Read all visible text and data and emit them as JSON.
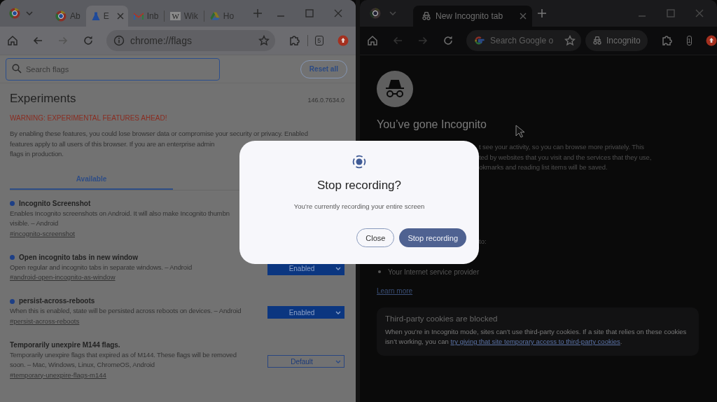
{
  "left_window": {
    "tabs": [
      {
        "kind": "chrome",
        "title": "Ab",
        "selected": false
      },
      {
        "kind": "flask",
        "title": "E",
        "selected": true
      },
      {
        "kind": "mail",
        "title": "Inb",
        "selected": false
      },
      {
        "kind": "letter",
        "favicon_letter": "W",
        "title": "Wik",
        "selected": false
      },
      {
        "kind": "drive",
        "title": "Ho",
        "selected": false
      }
    ],
    "toolbar": {
      "back_disabled": false,
      "forward_disabled": true,
      "address": "chrome://flags",
      "tab_count": "5"
    },
    "search": {
      "placeholder": "Search flags"
    },
    "reset_button": "Reset all",
    "heading": "Experiments",
    "version": "146.0.7634.0",
    "warning": "WARNING: EXPERIMENTAL FEATURES AHEAD!",
    "intro_lines": [
      "By enabling these features, you could lose browser data or compromise your security or privacy. Enabled",
      "features apply to all users of this browser. If you are an enterprise admin",
      "flags in production."
    ],
    "flag_tabs": [
      {
        "label": "Available",
        "selected": true
      }
    ],
    "flags": [
      {
        "name": "Incognito Screenshot",
        "modified": true,
        "description_lines": [
          "Enables Incognito screenshots on Android. It will also make Incognito thumbn",
          "visible. – Android"
        ],
        "link": "#incognito-screenshot"
      },
      {
        "name": "Open incognito tabs in new window",
        "modified": true,
        "description_lines": [
          "Open regular and incognito tabs in separate windows. – Android"
        ],
        "link": "#android-open-incognito-as-window",
        "select": "Enabled"
      },
      {
        "name": "persist-across-reboots",
        "modified": true,
        "description_lines": [
          "When this is enabled, state will be persisted across reboots on devices. – Android"
        ],
        "link": "#persist-across-reboots",
        "select": "Enabled"
      },
      {
        "name": "Temporarily unexpire M144 flags.",
        "modified": false,
        "description_lines": [
          "Temporarily unexpire flags that expired as of M144. These flags will be removed",
          "soon. – Mac, Windows, Linux, ChromeOS, Android"
        ],
        "link": "#temporary-unexpire-flags-m144",
        "select": "Default"
      }
    ]
  },
  "right_window": {
    "tabs": [
      {
        "kind": "incognito",
        "title": "New Incognito tab",
        "selected": true
      }
    ],
    "toolbar": {
      "back_disabled": true,
      "forward_disabled": true,
      "placeholder": "Search Google o",
      "chip": "Incognito",
      "tab_count": "1"
    },
    "heading": "You’ve gone Incognito",
    "intro_fragments": [
      "t see your activity, so you can browse more privately. This",
      "ted by websites that you visit and the services that they use,",
      "okmarks and reading list items will be saved."
    ],
    "list_intro_fragment": "to:",
    "list": [
      "Your Internet service provider"
    ],
    "learn_more": "Learn more",
    "cookies_card": {
      "title": "Third-party cookies are blocked",
      "text": "When you’re in Incognito mode, sites can’t use third-party cookies. If a site that relies on these cookies isn’t working, you can ",
      "link": "try giving that site temporary access to third-party cookies",
      "text_after": "."
    }
  },
  "dialog": {
    "title": "Stop recording?",
    "message": "You’re currently recording your entire screen",
    "buttons": [
      {
        "kind": "secondary",
        "label": "Close"
      },
      {
        "kind": "primary",
        "label": "Stop recording"
      }
    ]
  }
}
